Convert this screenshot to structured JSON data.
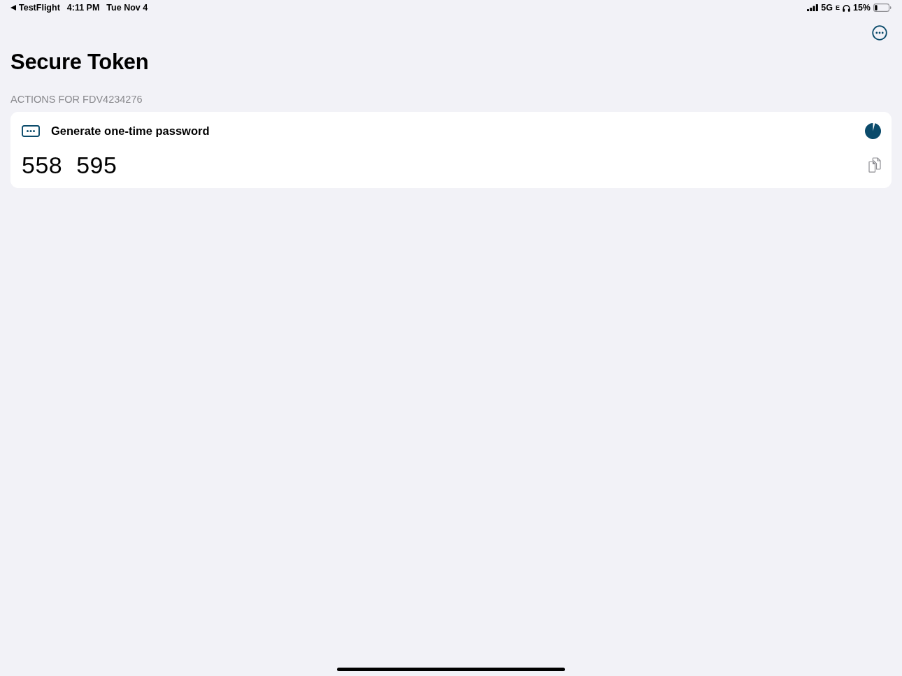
{
  "status_bar": {
    "back_app": "TestFlight",
    "time": "4:11 PM",
    "date": "Tue Nov 4",
    "network": "5G",
    "network_sub": "E",
    "battery": "15%"
  },
  "nav": {
    "title": "Secure Token"
  },
  "section": {
    "header": "ACTIONS FOR FDV4234276",
    "actions": [
      {
        "kind": "otp",
        "label": "Generate one-time password",
        "code": "558 595",
        "timer": {
          "level": 0.96
        }
      }
    ]
  }
}
